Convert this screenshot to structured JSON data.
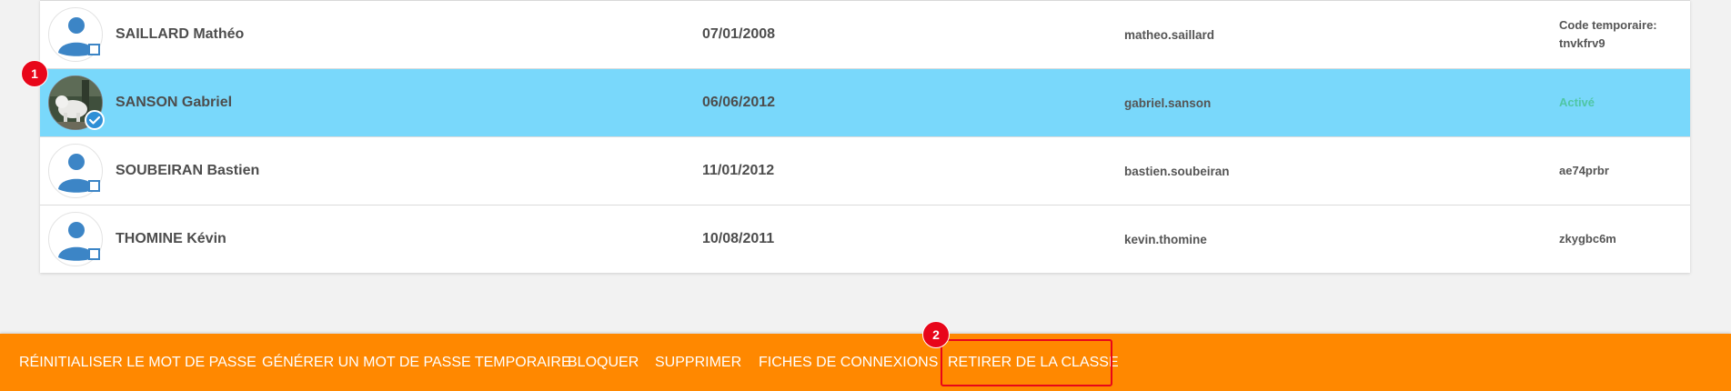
{
  "students": [
    {
      "name": "SAILLARD Mathéo",
      "birthdate": "07/01/2008",
      "login": "matheo.saillard",
      "status_line1": "Code temporaire:",
      "status_line2": "tnvkfrv9",
      "selected": false
    },
    {
      "name": "SANSON Gabriel",
      "birthdate": "06/06/2012",
      "login": "gabriel.sanson",
      "status": "Activé",
      "selected": true
    },
    {
      "name": "SOUBEIRAN Bastien",
      "birthdate": "11/01/2012",
      "login": "bastien.soubeiran",
      "status": "ae74prbr",
      "selected": false
    },
    {
      "name": "THOMINE Kévin",
      "birthdate": "10/08/2011",
      "login": "kevin.thomine",
      "status": "zkygbc6m",
      "selected": false
    }
  ],
  "markers": {
    "first": "1",
    "second": "2"
  },
  "toolbar": {
    "reset_password": "RÉINITIALISER LE MOT DE PASSE",
    "generate_temp_password": "GÉNÉRER UN MOT DE PASSE TEMPORAIRE",
    "block": "BLOQUER",
    "delete": "SUPPRIMER",
    "connection_sheets": "FICHES DE CONNEXIONS",
    "remove_from_class": "RETIRER DE LA CLASSE"
  },
  "colors": {
    "selected_row": "#79d8fb",
    "toolbar": "#ff8800",
    "marker": "#e8061a",
    "active_status": "#4fc6a4",
    "avatar_blue": "#3c85c6"
  },
  "icons": {
    "default_avatar": "person-icon",
    "select": "checkbox-icon",
    "selected": "check-circle-icon"
  }
}
